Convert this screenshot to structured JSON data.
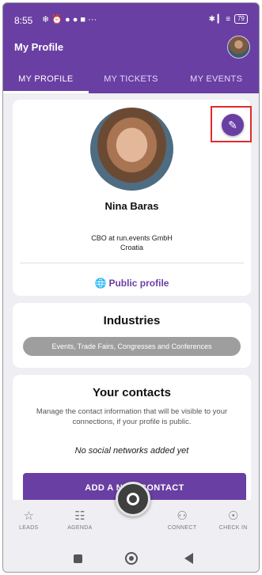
{
  "status_bar": {
    "time": "8:55",
    "left_icons": [
      "wind-icon",
      "alarm-icon",
      "whatsapp-icon",
      "facebook-icon",
      "b-icon",
      "more-dots-icon"
    ],
    "left_glyphs": "❄ ⏰ ● ● ■ ···",
    "right_icons": [
      "bluetooth-icon",
      "signal-icon",
      "wifi-icon",
      "battery-icon"
    ],
    "right_glyphs": "✱ ▎ ≡",
    "battery": "79"
  },
  "app_bar": {
    "title": "My Profile"
  },
  "tabs": [
    {
      "label": "MY PROFILE",
      "active": true
    },
    {
      "label": "MY TICKETS",
      "active": false
    },
    {
      "label": "MY EVENTS",
      "active": false
    }
  ],
  "profile": {
    "name": "Nina Baras",
    "role": "CBO at run.events GmbH",
    "country": "Croatia",
    "public_profile_label": "Public profile",
    "edit_icon": "✎"
  },
  "industries": {
    "title": "Industries",
    "chip": "Events, Trade Fairs, Congresses and Conferences"
  },
  "contacts": {
    "title": "Your contacts",
    "description": "Manage the contact information that will be visible to your connections, if your profile is public.",
    "empty_text": "No social networks added yet",
    "add_button": "ADD A NEW CONTACT"
  },
  "bottom_nav": {
    "leads": {
      "label": "LEADS",
      "icon": "☆"
    },
    "agenda": {
      "label": "AGENDA",
      "icon": "☷"
    },
    "connect": {
      "label": "CONNECT",
      "icon": "⚇"
    },
    "check_in": {
      "label": "CHECK IN",
      "icon": "☉"
    }
  },
  "colors": {
    "primary": "#6a3fa3",
    "highlight_box": "#e32b2b",
    "chip": "#9e9e9e"
  }
}
